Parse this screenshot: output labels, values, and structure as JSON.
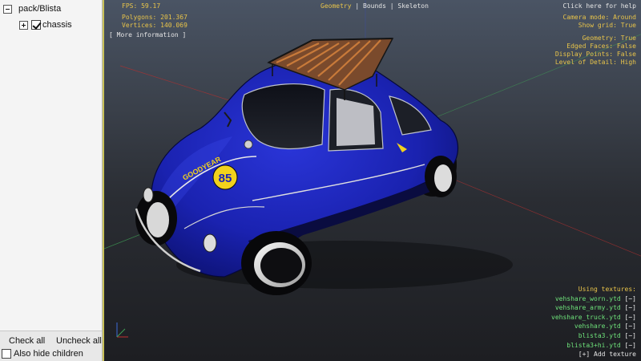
{
  "tree": {
    "root_label": "pack/Blista",
    "child_label": "chassis"
  },
  "bottom_bar": {
    "check_all": "Check all",
    "uncheck_all": "Uncheck all",
    "hide_children": "Also hide children"
  },
  "viewport": {
    "fps": "FPS: 59.17",
    "polygons": "Polygons: 201.367",
    "vertices": "Vertices: 140.069",
    "more_info": "[ More information ]",
    "tabs": {
      "geometry": "Geometry",
      "sep1": "|",
      "bounds": "Bounds",
      "sep2": "|",
      "skeleton": "Skeleton"
    },
    "help": "Click here for help",
    "settings": {
      "camera_mode": "Camera mode: Around",
      "show_grid": "Show grid: True",
      "geometry": "Geometry: True",
      "edged_faces": "Edged Faces: False",
      "display_points": "Display Points: False",
      "level_of_detail": "Level of Detail: High"
    },
    "textures": {
      "header": "Using textures:",
      "items": [
        {
          "name": "vehshare_worn.ytd",
          "button": "[−]"
        },
        {
          "name": "vehshare_army.ytd",
          "button": "[−]"
        },
        {
          "name": "vehshare_truck.ytd",
          "button": "[−]"
        },
        {
          "name": "vehshare.ytd",
          "button": "[−]"
        },
        {
          "name": "blista3.ytd",
          "button": "[−]"
        },
        {
          "name": "blista3+hi.ytd",
          "button": "[−]"
        }
      ],
      "add": "[+] Add texture"
    },
    "decal": {
      "number": "85",
      "brand": "GOODYEAR"
    }
  },
  "colors": {
    "hud_yellow": "#e8c44a",
    "hud_green": "#6ee27a",
    "car_body": "#1a22b8",
    "decal_yellow": "#f2d21c"
  }
}
